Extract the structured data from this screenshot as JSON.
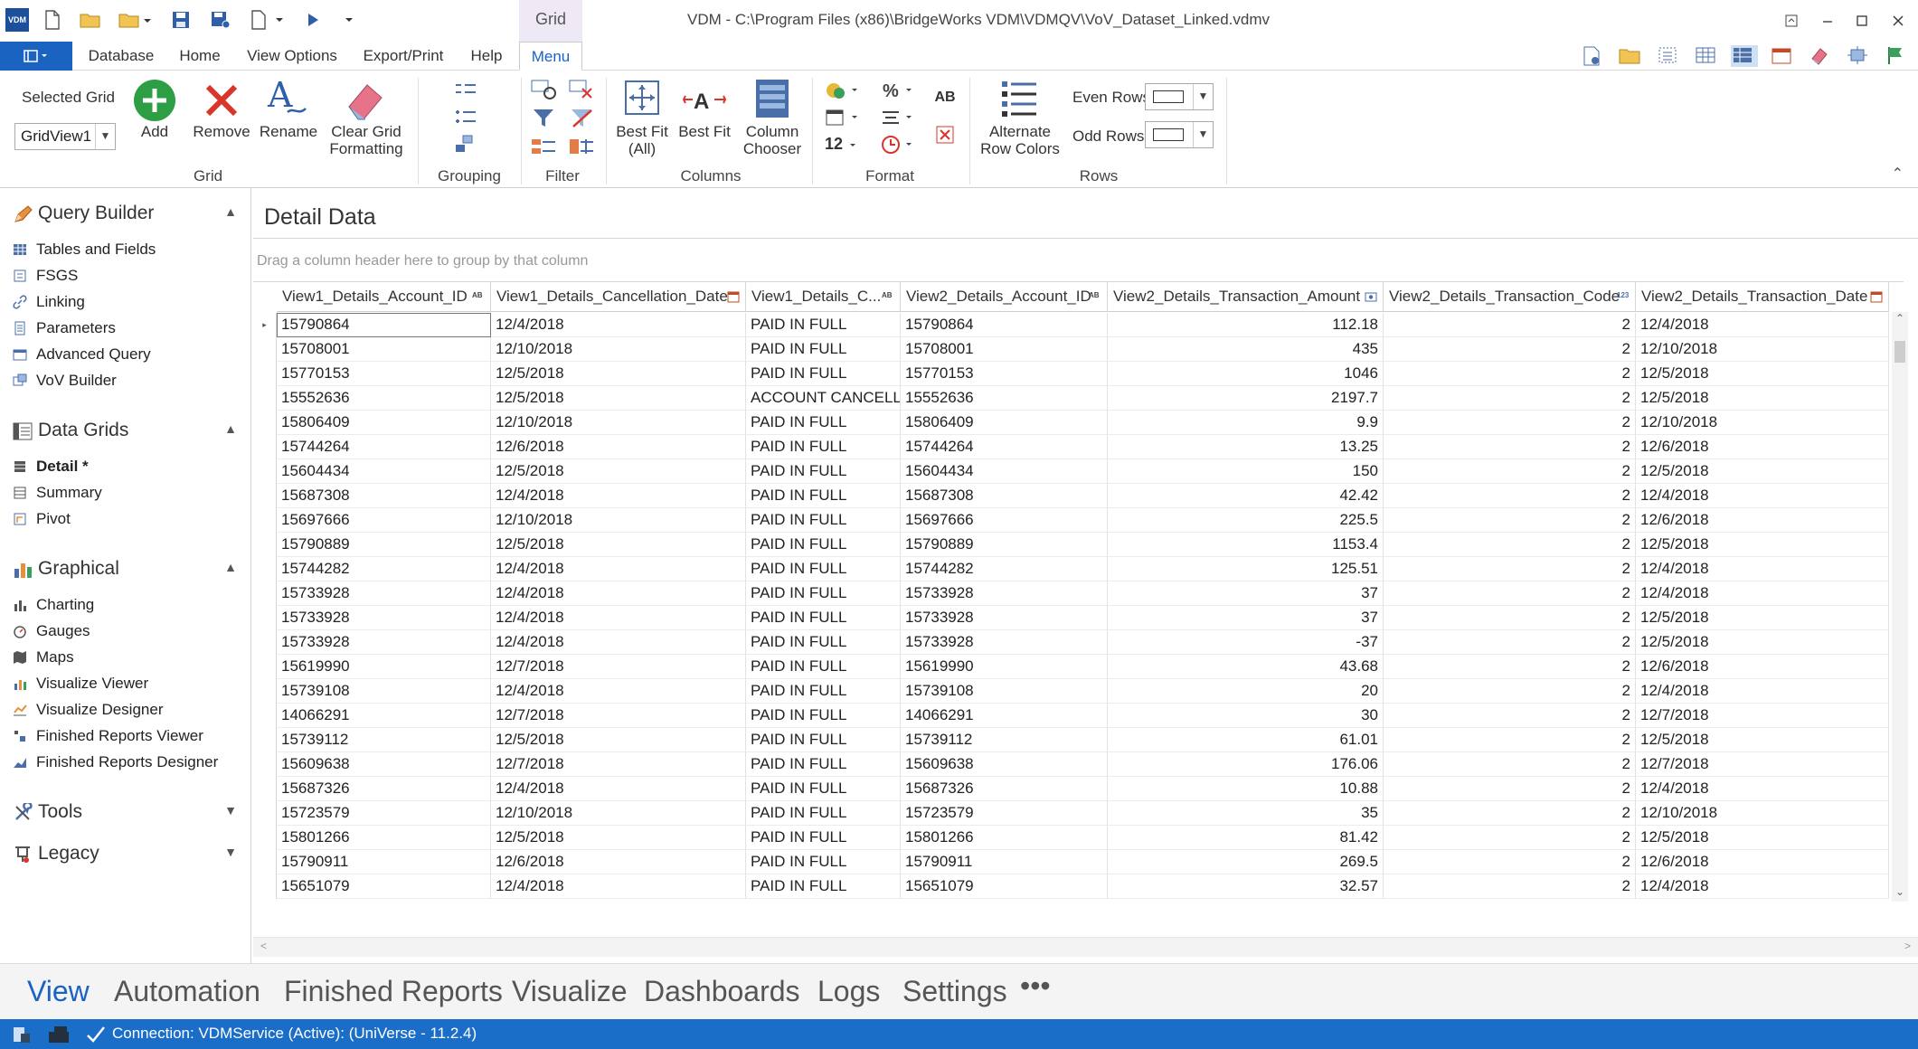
{
  "app": {
    "logo_text": "VDM",
    "window_title": "VDM - C:\\Program Files (x86)\\BridgeWorks VDM\\VDMQV\\VoV_Dataset_Linked.vdmv",
    "context_tab_group": "Grid"
  },
  "ribbon_tabs": [
    "Database",
    "Home",
    "View Options",
    "Export/Print",
    "Help",
    "Menu"
  ],
  "ribbon": {
    "selected_grid_label": "Selected Grid",
    "selected_grid_value": "GridView1",
    "add": "Add",
    "remove": "Remove",
    "rename": "Rename",
    "clear_grid_formatting_1": "Clear Grid",
    "clear_grid_formatting_2": "Formatting",
    "group_grid": "Grid",
    "group_grouping": "Grouping",
    "group_filter": "Filter",
    "best_fit_all_1": "Best Fit",
    "best_fit_all_2": "(All)",
    "best_fit": "Best Fit",
    "column_chooser_1": "Column",
    "column_chooser_2": "Chooser",
    "group_columns": "Columns",
    "format_12": "12",
    "format_ab": "AB",
    "group_format": "Format",
    "alternate_row_colors_1": "Alternate",
    "alternate_row_colors_2": "Row Colors",
    "even_rows": "Even Rows",
    "odd_rows": "Odd Rows",
    "group_rows": "Rows"
  },
  "sidebar": {
    "query_builder": {
      "title": "Query Builder",
      "items": [
        "Tables and Fields",
        "FSGS",
        "Linking",
        "Parameters",
        "Advanced Query",
        "VoV Builder"
      ]
    },
    "data_grids": {
      "title": "Data Grids",
      "items": [
        "Detail *",
        "Summary",
        "Pivot"
      ]
    },
    "graphical": {
      "title": "Graphical",
      "items": [
        "Charting",
        "Gauges",
        "Maps",
        "Visualize Viewer",
        "Visualize Designer",
        "Finished Reports Viewer",
        "Finished Reports Designer"
      ]
    },
    "tools": {
      "title": "Tools"
    },
    "legacy": {
      "title": "Legacy"
    }
  },
  "main": {
    "title": "Detail Data",
    "group_hint": "Drag a column header here to group by that column",
    "columns": [
      {
        "label": "View1_Details_Account_ID",
        "icon": "AB"
      },
      {
        "label": "View1_Details_Cancellation_Date",
        "icon": "calendar"
      },
      {
        "label": "View1_Details_C...",
        "icon": "AB"
      },
      {
        "label": "View2_Details_Account_ID",
        "icon": "AB"
      },
      {
        "label": "View2_Details_Transaction_Amount",
        "icon": "money"
      },
      {
        "label": "View2_Details_Transaction_Code",
        "icon": "123"
      },
      {
        "label": "View2_Details_Transaction_Date",
        "icon": "calendar"
      }
    ],
    "rows": [
      [
        "15790864",
        "12/4/2018",
        "PAID IN FULL",
        "15790864",
        "112.18",
        "2",
        "12/4/2018"
      ],
      [
        "15708001",
        "12/10/2018",
        "PAID IN FULL",
        "15708001",
        "435",
        "2",
        "12/10/2018"
      ],
      [
        "15770153",
        "12/5/2018",
        "PAID IN FULL",
        "15770153",
        "1046",
        "2",
        "12/5/2018"
      ],
      [
        "15552636",
        "12/5/2018",
        "ACCOUNT CANCELL...",
        "15552636",
        "2197.7",
        "2",
        "12/5/2018"
      ],
      [
        "15806409",
        "12/10/2018",
        "PAID IN FULL",
        "15806409",
        "9.9",
        "2",
        "12/10/2018"
      ],
      [
        "15744264",
        "12/6/2018",
        "PAID IN FULL",
        "15744264",
        "13.25",
        "2",
        "12/6/2018"
      ],
      [
        "15604434",
        "12/5/2018",
        "PAID IN FULL",
        "15604434",
        "150",
        "2",
        "12/5/2018"
      ],
      [
        "15687308",
        "12/4/2018",
        "PAID IN FULL",
        "15687308",
        "42.42",
        "2",
        "12/4/2018"
      ],
      [
        "15697666",
        "12/10/2018",
        "PAID IN FULL",
        "15697666",
        "225.5",
        "2",
        "12/6/2018"
      ],
      [
        "15790889",
        "12/5/2018",
        "PAID IN FULL",
        "15790889",
        "1153.4",
        "2",
        "12/5/2018"
      ],
      [
        "15744282",
        "12/4/2018",
        "PAID IN FULL",
        "15744282",
        "125.51",
        "2",
        "12/4/2018"
      ],
      [
        "15733928",
        "12/4/2018",
        "PAID IN FULL",
        "15733928",
        "37",
        "2",
        "12/4/2018"
      ],
      [
        "15733928",
        "12/4/2018",
        "PAID IN FULL",
        "15733928",
        "37",
        "2",
        "12/5/2018"
      ],
      [
        "15733928",
        "12/4/2018",
        "PAID IN FULL",
        "15733928",
        "-37",
        "2",
        "12/5/2018"
      ],
      [
        "15619990",
        "12/7/2018",
        "PAID IN FULL",
        "15619990",
        "43.68",
        "2",
        "12/6/2018"
      ],
      [
        "15739108",
        "12/4/2018",
        "PAID IN FULL",
        "15739108",
        "20",
        "2",
        "12/4/2018"
      ],
      [
        "14066291",
        "12/7/2018",
        "PAID IN FULL",
        "14066291",
        "30",
        "2",
        "12/7/2018"
      ],
      [
        "15739112",
        "12/5/2018",
        "PAID IN FULL",
        "15739112",
        "61.01",
        "2",
        "12/5/2018"
      ],
      [
        "15609638",
        "12/7/2018",
        "PAID IN FULL",
        "15609638",
        "176.06",
        "2",
        "12/7/2018"
      ],
      [
        "15687326",
        "12/4/2018",
        "PAID IN FULL",
        "15687326",
        "10.88",
        "2",
        "12/4/2018"
      ],
      [
        "15723579",
        "12/10/2018",
        "PAID IN FULL",
        "15723579",
        "35",
        "2",
        "12/10/2018"
      ],
      [
        "15801266",
        "12/5/2018",
        "PAID IN FULL",
        "15801266",
        "81.42",
        "2",
        "12/5/2018"
      ],
      [
        "15790911",
        "12/6/2018",
        "PAID IN FULL",
        "15790911",
        "269.5",
        "2",
        "12/6/2018"
      ],
      [
        "15651079",
        "12/4/2018",
        "PAID IN FULL",
        "15651079",
        "32.57",
        "2",
        "12/4/2018"
      ]
    ]
  },
  "bottom_tabs": [
    "View",
    "Automation",
    "Finished Reports",
    "Visualize",
    "Dashboards",
    "Logs",
    "Settings",
    "•••"
  ],
  "status": {
    "connection": "Connection: VDMService (Active): (UniVerse - 11.2.4)"
  },
  "colors": {
    "accent": "#1a63c1",
    "status_bar": "#1a6ec7",
    "add_green": "#2e9e44",
    "remove_red": "#d9352a"
  }
}
